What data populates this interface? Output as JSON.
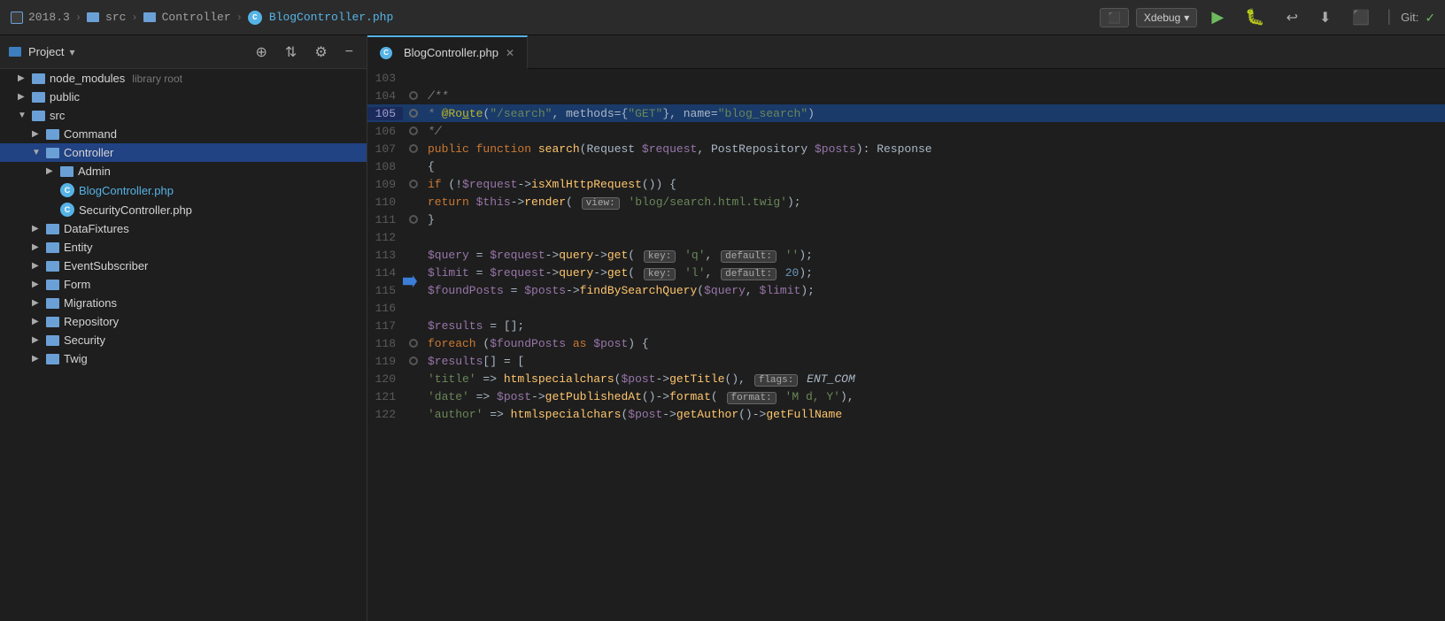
{
  "titlebar": {
    "breadcrumbs": [
      {
        "label": "2018.3",
        "active": false
      },
      {
        "label": "src",
        "active": false
      },
      {
        "label": "Controller",
        "active": false
      },
      {
        "label": "BlogController.php",
        "active": true
      }
    ],
    "xdebug_label": "Xdebug",
    "git_label": "Git:"
  },
  "sidebar": {
    "project_label": "Project",
    "items": [
      {
        "id": "node_modules",
        "label": "node_modules",
        "sublabel": "library root",
        "indent": 0,
        "type": "folder",
        "expanded": false
      },
      {
        "id": "public",
        "label": "public",
        "indent": 0,
        "type": "folder",
        "expanded": false
      },
      {
        "id": "src",
        "label": "src",
        "indent": 0,
        "type": "folder",
        "expanded": true
      },
      {
        "id": "command",
        "label": "Command",
        "indent": 1,
        "type": "folder",
        "expanded": false
      },
      {
        "id": "controller",
        "label": "Controller",
        "indent": 1,
        "type": "folder",
        "expanded": true,
        "selected": true
      },
      {
        "id": "admin",
        "label": "Admin",
        "indent": 2,
        "type": "folder",
        "expanded": false
      },
      {
        "id": "blogcontroller",
        "label": "BlogController.php",
        "indent": 2,
        "type": "php"
      },
      {
        "id": "securitycontroller",
        "label": "SecurityController.php",
        "indent": 2,
        "type": "php",
        "truncated": true
      },
      {
        "id": "datafixtures",
        "label": "DataFixtures",
        "indent": 1,
        "type": "folder",
        "expanded": false
      },
      {
        "id": "entity",
        "label": "Entity",
        "indent": 1,
        "type": "folder",
        "expanded": false
      },
      {
        "id": "eventsubscriber",
        "label": "EventSubscriber",
        "indent": 1,
        "type": "folder",
        "expanded": false
      },
      {
        "id": "form",
        "label": "Form",
        "indent": 1,
        "type": "folder",
        "expanded": false
      },
      {
        "id": "migrations",
        "label": "Migrations",
        "indent": 1,
        "type": "folder",
        "expanded": false
      },
      {
        "id": "repository",
        "label": "Repository",
        "indent": 1,
        "type": "folder",
        "expanded": false
      },
      {
        "id": "security",
        "label": "Security",
        "indent": 1,
        "type": "folder",
        "expanded": false
      },
      {
        "id": "twig",
        "label": "Twig",
        "indent": 1,
        "type": "folder",
        "expanded": false
      }
    ]
  },
  "editor": {
    "tab_label": "BlogController.php",
    "lines": [
      {
        "num": 103,
        "content": "",
        "breakpoint": "none"
      },
      {
        "num": 104,
        "content": "        /**",
        "breakpoint": "hollow"
      },
      {
        "num": 105,
        "content": "         * @Route(\"/search\", methods={\"GET\"}, name=\"blog_search\")",
        "breakpoint": "hollow",
        "active": true
      },
      {
        "num": 106,
        "content": "         */",
        "breakpoint": "hollow"
      },
      {
        "num": 107,
        "content": "        public function search(Request $request, PostRepository $posts): Response",
        "breakpoint": "hollow"
      },
      {
        "num": 108,
        "content": "        {",
        "breakpoint": "none"
      },
      {
        "num": 109,
        "content": "            if (!$request->isXmlHttpRequest()) {",
        "breakpoint": "hollow"
      },
      {
        "num": 110,
        "content": "                return $this->render( view:  'blog/search.html.twig');",
        "breakpoint": "none"
      },
      {
        "num": 111,
        "content": "            }",
        "breakpoint": "hollow"
      },
      {
        "num": 112,
        "content": "",
        "breakpoint": "none"
      },
      {
        "num": 113,
        "content": "            $query = $request->query->get( key:  'q',  default:  '');",
        "breakpoint": "none"
      },
      {
        "num": 114,
        "content": "            $limit = $request->query->get( key:  'l',  default:  20);",
        "breakpoint": "none",
        "execution": true
      },
      {
        "num": 115,
        "content": "            $foundPosts = $posts->findBySearchQuery($query, $limit);",
        "breakpoint": "none"
      },
      {
        "num": 116,
        "content": "",
        "breakpoint": "none"
      },
      {
        "num": 117,
        "content": "            $results = [];",
        "breakpoint": "none"
      },
      {
        "num": 118,
        "content": "            foreach ($foundPosts as $post) {",
        "breakpoint": "hollow"
      },
      {
        "num": 119,
        "content": "                $results[] = [",
        "breakpoint": "hollow"
      },
      {
        "num": 120,
        "content": "                    'title' => htmlspecialchars($post->getTitle(),  flags:  ENT_COM",
        "breakpoint": "none"
      },
      {
        "num": 121,
        "content": "                    'date' => $post->getPublishedAt()->format( format:  'M d, Y'),",
        "breakpoint": "none"
      },
      {
        "num": 122,
        "content": "                    'author' => htmlspecialchars($post->getAuthor()->getFullName",
        "breakpoint": "none"
      }
    ]
  }
}
